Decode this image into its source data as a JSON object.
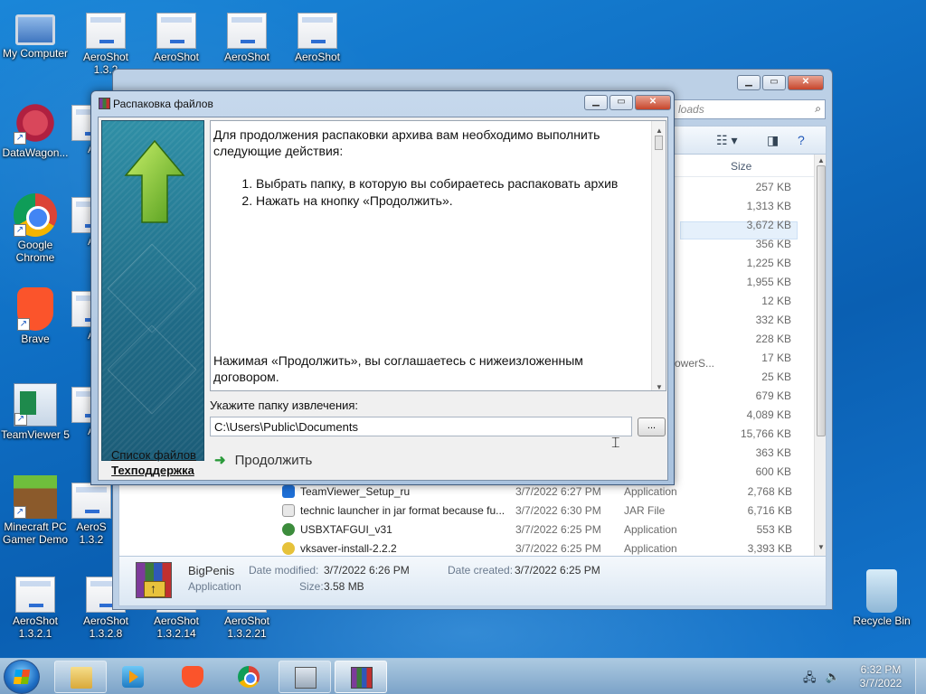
{
  "desktop": {
    "icons": [
      {
        "label": "My Computer"
      },
      {
        "label": "AeroShot\n1.3.2"
      },
      {
        "label": "AeroShot"
      },
      {
        "label": "AeroShot"
      },
      {
        "label": "AeroShot"
      },
      {
        "label": "DataWagon..."
      },
      {
        "label": "Google\nChrome"
      },
      {
        "label": "Brave"
      },
      {
        "label": "TeamViewer 5"
      },
      {
        "label": "Minecraft PC\nGamer Demo"
      },
      {
        "label": "AeroShot\n1.3.2.1"
      },
      {
        "label": "AeroShot\n1.3.2.8"
      },
      {
        "label": "AeroShot\n1.3.2.14"
      },
      {
        "label": "AeroShot\n1.3.2.21"
      },
      {
        "label": "Recycle Bin"
      },
      {
        "label": "A"
      },
      {
        "label": "A"
      },
      {
        "label": "A"
      },
      {
        "label": "A"
      },
      {
        "label": "A"
      },
      {
        "label": "AeroS\n1.3.2"
      }
    ]
  },
  "explorer": {
    "search_placeholder": "loads",
    "size_header": "Size",
    "sizes": [
      "257 KB",
      "1,313 KB",
      "3,672 KB",
      "356 KB",
      "1,225 KB",
      "1,955 KB",
      "12 KB",
      "332 KB",
      "228 KB",
      "17 KB",
      "25 KB",
      "679 KB",
      "4,089 KB",
      "15,766 KB",
      "363 KB",
      "600 KB"
    ],
    "type_fragment": "owerS...",
    "rows": [
      {
        "name": "TeamViewer_Setup_ru",
        "date": "3/7/2022 6:27 PM",
        "type": "Application",
        "size": "2,768 KB"
      },
      {
        "name": "technic launcher in jar format because fu...",
        "date": "3/7/2022 6:30 PM",
        "type": "JAR File",
        "size": "6,716 KB"
      },
      {
        "name": "USBXTAFGUI_v31",
        "date": "3/7/2022 6:25 PM",
        "type": "Application",
        "size": "553 KB"
      },
      {
        "name": "vksaver-install-2.2.2",
        "date": "3/7/2022 6:25 PM",
        "type": "Application",
        "size": "3,393 KB"
      }
    ],
    "details": {
      "name": "BigPenis",
      "type": "Application",
      "modified_label": "Date modified:",
      "modified_value": "3/7/2022 6:26 PM",
      "created_label": "Date created:",
      "created_value": "3/7/2022 6:25 PM",
      "size_label": "Size:",
      "size_value": "3.58 MB"
    }
  },
  "dialog": {
    "title": "Распаковка файлов",
    "intro": "Для продолжения распаковки архива вам необходимо выполнить следующие действия:",
    "steps": [
      "Выбрать папку, в которую вы собираетесь распаковать архив",
      "Нажать на кнопку «Продолжить»."
    ],
    "agreement": "Нажимая «Продолжить», вы соглашаетесь с нижеизложенным договором.",
    "folder_label": "Укажите папку извлечения:",
    "folder_value": "C:\\Users\\Public\\Documents",
    "browse_label": "...",
    "continue_label": "Продолжить",
    "file_list_link": "Список файлов",
    "support_link": "Техподдержка"
  },
  "taskbar": {
    "time": "6:32 PM",
    "date": "3/7/2022"
  }
}
